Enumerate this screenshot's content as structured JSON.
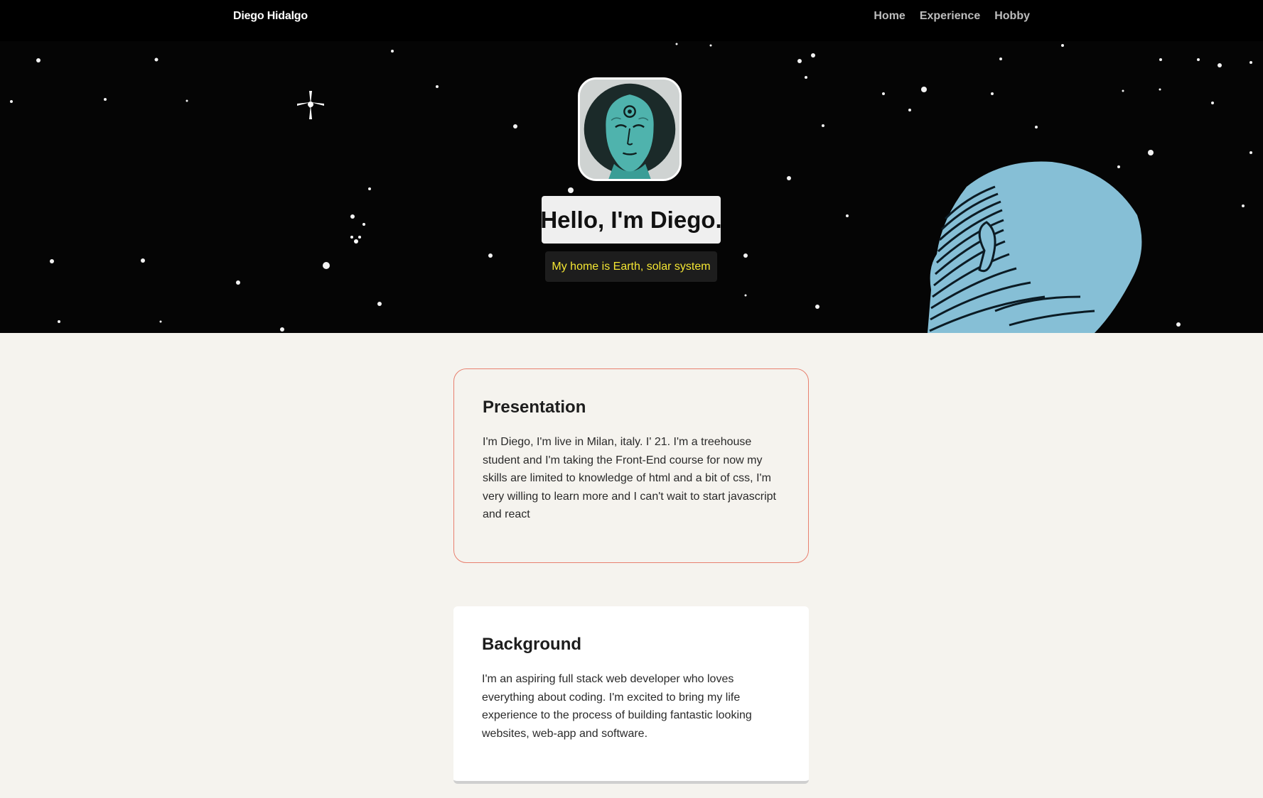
{
  "nav": {
    "brand": "Diego Hidalgo",
    "links": [
      "Home",
      "Experience",
      "Hobby"
    ]
  },
  "hero": {
    "title": "Hello, I'm Diego.",
    "subtitle": "My home is Earth, solar system",
    "avatar_icon": "doctor-manhattan-portrait",
    "head_icon": "blue-head-illustration"
  },
  "presentation": {
    "heading": "Presentation",
    "text": "I'm Diego, I'm live in Milan, italy. I' 21. I'm a treehouse student and I'm taking the Front-End course for now my skills are limited to knowledge of html and a bit of css, I'm very willing to learn more and I can't wait to start javascript and react"
  },
  "background": {
    "heading": "Background",
    "text": "I'm an aspiring full stack web developer who loves everything about coding. I'm excited to bring my life experience to the process of building fantastic looking websites, web-app and software."
  },
  "colors": {
    "nav_bg": "#000000",
    "page_bg": "#f5f3ee",
    "subtitle_text": "#f4e633",
    "card_border": "#e8806f"
  }
}
